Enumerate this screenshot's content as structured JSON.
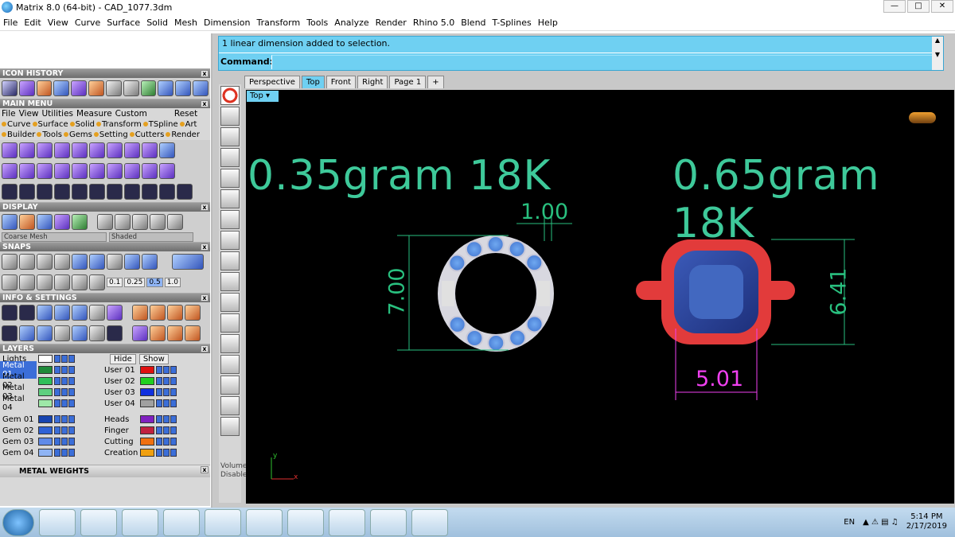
{
  "window": {
    "title": "Matrix 8.0 (64-bit) - CAD_1077.3dm"
  },
  "menubar": [
    "File",
    "Edit",
    "View",
    "Curve",
    "Surface",
    "Solid",
    "Mesh",
    "Dimension",
    "Transform",
    "Tools",
    "Analyze",
    "Render",
    "Rhino 5.0",
    "Blend",
    "T-Splines",
    "Help"
  ],
  "panels": {
    "icon_history": "ICON HISTORY",
    "main_menu": "MAIN MENU",
    "main_menu_items": [
      "File",
      "View",
      "Utilities",
      "Measure",
      "Custom",
      "Reset"
    ],
    "main_menu_row2": [
      "Curve",
      "Surface",
      "Solid",
      "Transform",
      "TSpline",
      "Art"
    ],
    "main_menu_row3": [
      "Builder",
      "Tools",
      "Gems",
      "Setting",
      "Cutters",
      "Render"
    ],
    "display": "DISPLAY",
    "display_mesh": "Coarse Mesh",
    "display_shade": "Shaded",
    "snaps": "SNAPS",
    "snap_values": [
      "0.1",
      "0.25",
      "0.5",
      "1.0"
    ],
    "info_settings": "INFO & SETTINGS",
    "layers": "LAYERS",
    "hide": "Hide",
    "show": "Show",
    "metal_weights": "METAL WEIGHTS"
  },
  "layers_left": [
    {
      "name": "Lights",
      "color": "#ffffff"
    },
    {
      "name": "Metal 01",
      "color": "#1f8a3a",
      "selected": true
    },
    {
      "name": "Metal 02",
      "color": "#2fbf5a"
    },
    {
      "name": "Metal 03",
      "color": "#5fd080"
    },
    {
      "name": "Metal 04",
      "color": "#9ee8a8"
    },
    {
      "name": "Gem 01",
      "color": "#1744b0"
    },
    {
      "name": "Gem 02",
      "color": "#2f62d6"
    },
    {
      "name": "Gem 03",
      "color": "#5f8ae8"
    },
    {
      "name": "Gem 04",
      "color": "#8fb4f4"
    }
  ],
  "layers_right": [
    {
      "name": "User 01",
      "color": "#e01010"
    },
    {
      "name": "User 02",
      "color": "#20d020"
    },
    {
      "name": "User 03",
      "color": "#1030e0"
    },
    {
      "name": "User 04",
      "color": "#a0a0a0"
    },
    {
      "name": "Heads",
      "color": "#8020c0"
    },
    {
      "name": "Finger",
      "color": "#c02040"
    },
    {
      "name": "Cutting",
      "color": "#f07010"
    },
    {
      "name": "Creation",
      "color": "#f0a010"
    }
  ],
  "command": {
    "message": "1 linear dimension added to selection.",
    "label": "Command:",
    "value": ""
  },
  "tabs": [
    "Perspective",
    "Top",
    "Front",
    "Right",
    "Page 1"
  ],
  "viewport": {
    "name": "Top",
    "text_left": "0.35gram 18K",
    "text_right": "0.65gram 18K",
    "dim_gap": "1.00",
    "dim_height_left": "7.00",
    "dim_height_right": "6.41",
    "dim_width_right": "5.01",
    "axis_x": "x",
    "axis_y": "y"
  },
  "left_vert_label": "Volume Disabled",
  "tray": {
    "lang": "EN",
    "time": "5:14 PM",
    "date": "2/17/2019"
  }
}
